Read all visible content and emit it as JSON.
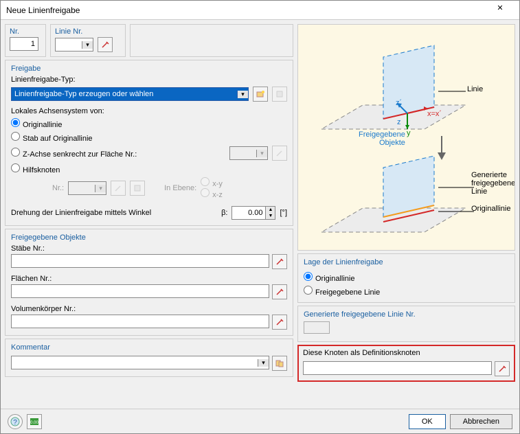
{
  "window": {
    "title": "Neue Linienfreigabe"
  },
  "tabs": {
    "nr_label": "Nr.",
    "nr_value": "1",
    "line_nr_label": "Linie Nr.",
    "line_nr_value": ""
  },
  "freigabe": {
    "header": "Freigabe",
    "type_label": "Linienfreigabe-Typ:",
    "type_value": "Linienfreigabe-Typ erzeugen oder wählen",
    "local_axis_label": "Lokales Achsensystem von:",
    "options": {
      "original": "Originallinie",
      "stab": "Stab auf Originallinie",
      "zaxis": "Z-Achse senkrecht zur Fläche Nr.:",
      "hilfs": "Hilfsknoten"
    },
    "nr_label": "Nr.:",
    "in_ebene_label": "In Ebene:",
    "plane_xy": "x-y",
    "plane_xz": "x-z",
    "rotation_label": "Drehung der Linienfreigabe mittels Winkel",
    "beta_label": "β:",
    "beta_value": "0.00",
    "beta_unit": "[°]"
  },
  "released": {
    "header": "Freigegebene Objekte",
    "stabe_label": "Stäbe Nr.:",
    "flachen_label": "Flächen Nr.:",
    "volumen_label": "Volumenkörper Nr.:"
  },
  "kommentar": {
    "header": "Kommentar",
    "value": ""
  },
  "diagram": {
    "linie": "Linie",
    "freig_obj": "Freigegebene\nObjekte",
    "gen_linie": "Generierte\nfreigegebene\nLinie",
    "orig_linie": "Originallinie",
    "z_prime": "z´",
    "z": "z",
    "y": "y",
    "x": "x=x´"
  },
  "lage": {
    "header": "Lage der Linienfreigabe",
    "original": "Originallinie",
    "freig": "Freigegebene Linie"
  },
  "gen_line": {
    "header": "Generierte freigegebene Linie Nr."
  },
  "def_nodes": {
    "header": "Diese Knoten als Definitionsknoten",
    "value": ""
  },
  "buttons": {
    "ok": "OK",
    "cancel": "Abbrechen"
  }
}
